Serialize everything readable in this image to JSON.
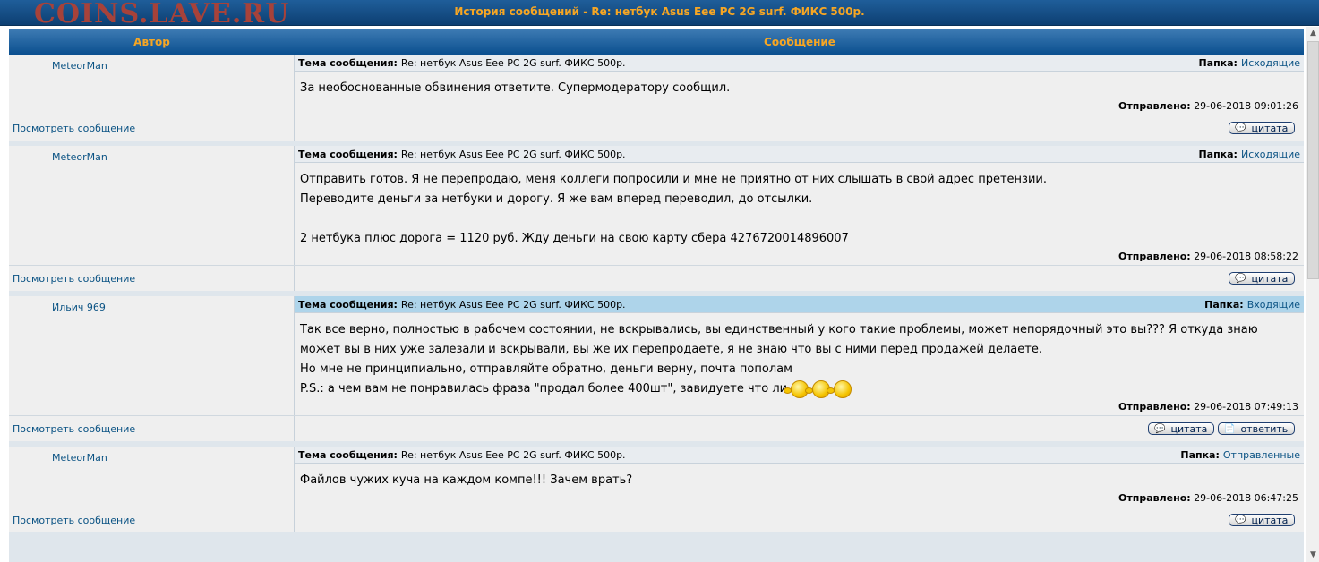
{
  "window": {
    "watermark": "COINS.LAVE.RU",
    "title": "История сообщений - Re: нетбук Asus Eee PC 2G surf. ФИКС 500р."
  },
  "table": {
    "col_author": "Автор",
    "col_message": "Сообщение"
  },
  "labels": {
    "subject": "Тема сообщения:",
    "folder": "Папка:",
    "sent": "Отправлено:",
    "view_message": "Посмотреть сообщение",
    "quote": "цитата",
    "reply": "ответить"
  },
  "messages": [
    {
      "author": "MeteorMan",
      "subject": "Re: нетбук Asus Eee PC 2G surf. ФИКС 500р.",
      "folder": "Исходящие",
      "lines": [
        "За необоснованные обвинения ответите. Супермодератору сообщил."
      ],
      "sent": "29-06-2018 09:01:26"
    },
    {
      "author": "MeteorMan",
      "subject": "Re: нетбук Asus Eee PC 2G surf. ФИКС 500р.",
      "folder": "Исходящие",
      "lines": [
        "Отправить готов. Я не перепродаю, меня коллеги попросили и мне не приятно от них слышать в свой адрес претензии.",
        "Переводите деньги за нетбуки и дорогу. Я же вам вперед переводил, до отсылки.",
        "",
        "2 нетбука плюс дорога = 1120 руб. Жду деньги на свою карту сбера 4276720014896007"
      ],
      "sent": "29-06-2018 08:58:22"
    },
    {
      "author": "Ильич 969",
      "subject": "Re: нетбук Asus Eee PC 2G surf. ФИКС 500р.",
      "folder": "Входящие",
      "lines": [
        "Так все верно, полностью в рабочем состоянии, не вскрывались, вы единственный у кого такие проблемы, может непорядочный это вы??? Я откуда знаю может вы в них уже залезали и вскрывали, вы же их перепродаете, я не знаю что вы с ними перед продажей делаете.",
        "Но мне не принципиально, отправляйте обратно, деньги верну, почта пополам",
        "P.S.: а чем вам не понравилась фраза \"продал более 400шт\", завидуете что ли"
      ],
      "sent": "29-06-2018 07:49:13"
    },
    {
      "author": "MeteorMan",
      "subject": "Re: нетбук Asus Eee PC 2G surf. ФИКС 500р.",
      "folder": "Отправленные",
      "lines": [
        "Файлов чужих куча на каждом компе!!! Зачем врать?"
      ],
      "sent": "29-06-2018 06:47:25"
    }
  ]
}
